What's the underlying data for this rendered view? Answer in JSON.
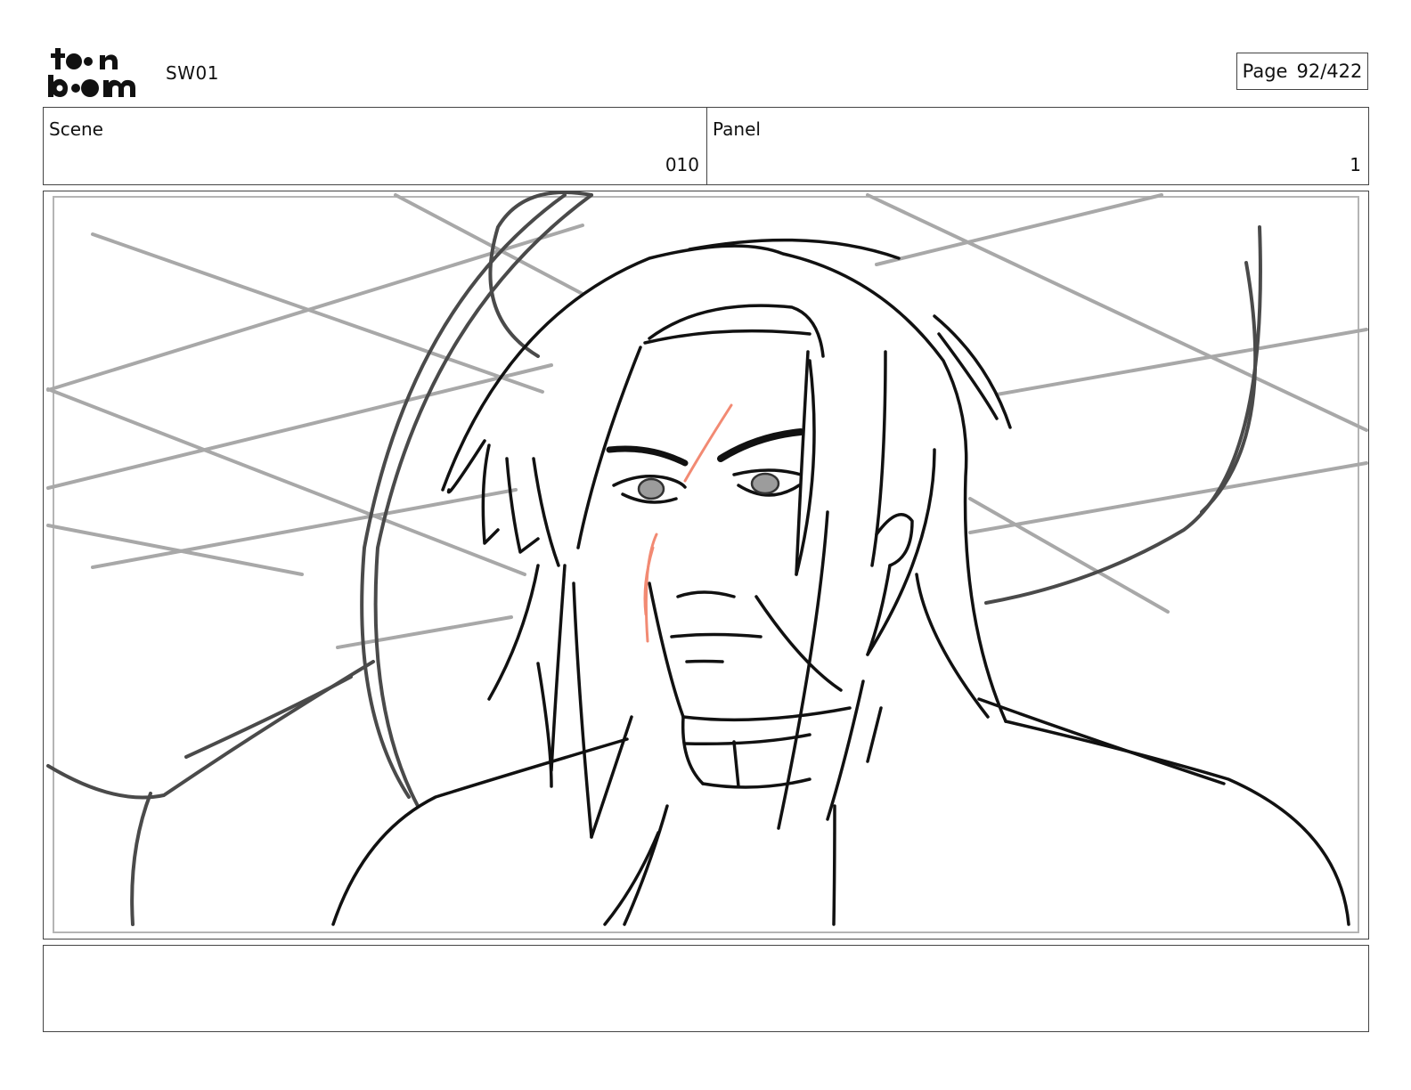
{
  "header": {
    "logo_text": "toon boom",
    "project": "SW01",
    "page_label": "Page",
    "page_value": "92/422"
  },
  "info": {
    "scene_label": "Scene",
    "scene_value": "010",
    "panel_label": "Panel",
    "panel_value": "1"
  },
  "drawing": {
    "description_tag": "storyboard-sketch",
    "line_color": "#111111",
    "construction_color": "#a8a8a8",
    "scar_color": "#f28a73"
  },
  "notes": {
    "text": ""
  }
}
